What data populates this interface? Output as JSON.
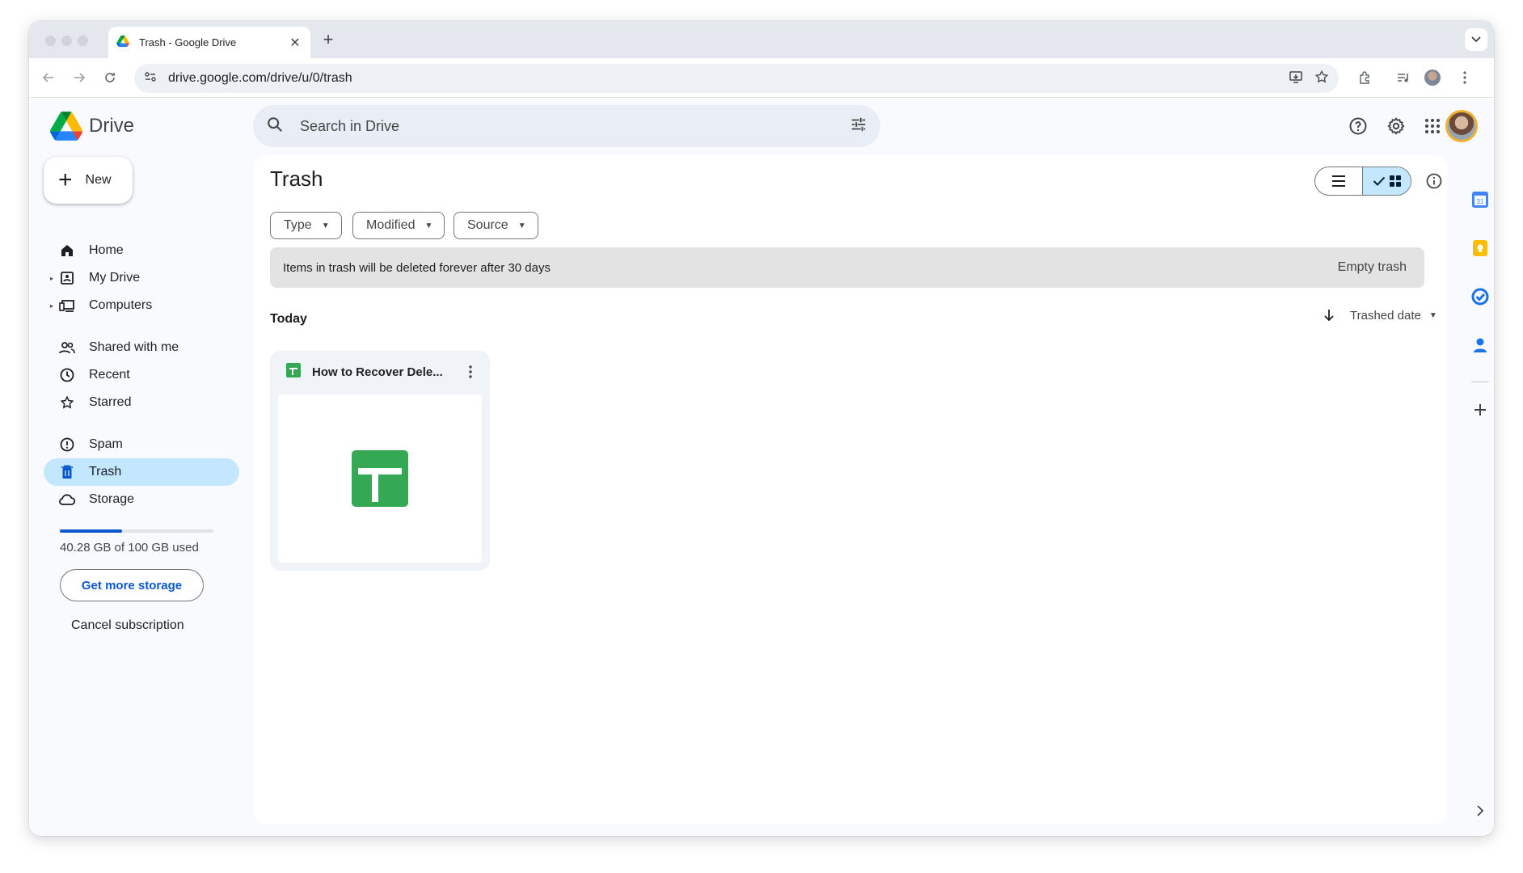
{
  "browser": {
    "tab_title": "Trash - Google Drive",
    "url": "drive.google.com/drive/u/0/trash"
  },
  "app": {
    "name": "Drive",
    "search_placeholder": "Search in Drive"
  },
  "sidebar": {
    "new_label": "New",
    "items": [
      {
        "label": "Home",
        "icon": "home-icon"
      },
      {
        "label": "My Drive",
        "icon": "my-drive-icon"
      },
      {
        "label": "Computers",
        "icon": "computers-icon"
      },
      {
        "label": "Shared with me",
        "icon": "shared-icon"
      },
      {
        "label": "Recent",
        "icon": "clock-icon"
      },
      {
        "label": "Starred",
        "icon": "star-icon"
      },
      {
        "label": "Spam",
        "icon": "spam-icon"
      },
      {
        "label": "Trash",
        "icon": "trash-icon",
        "active": true
      },
      {
        "label": "Storage",
        "icon": "cloud-icon"
      }
    ],
    "storage": {
      "used_fraction": 0.4028,
      "text": "40.28 GB of 100 GB used",
      "get_more_label": "Get more storage",
      "cancel_label": "Cancel subscription"
    }
  },
  "main": {
    "title": "Trash",
    "filters": [
      "Type",
      "Modified",
      "Source"
    ],
    "banner_text": "Items in trash will be deleted forever after 30 days",
    "empty_trash_label": "Empty trash",
    "section_label": "Today",
    "sort_label": "Trashed date",
    "files": [
      {
        "name": "How to Recover Dele...",
        "type": "google-sheets"
      }
    ]
  },
  "colors": {
    "accent": "#0b57d0",
    "active_nav": "#c2e7ff",
    "sheets_green": "#34a853"
  }
}
